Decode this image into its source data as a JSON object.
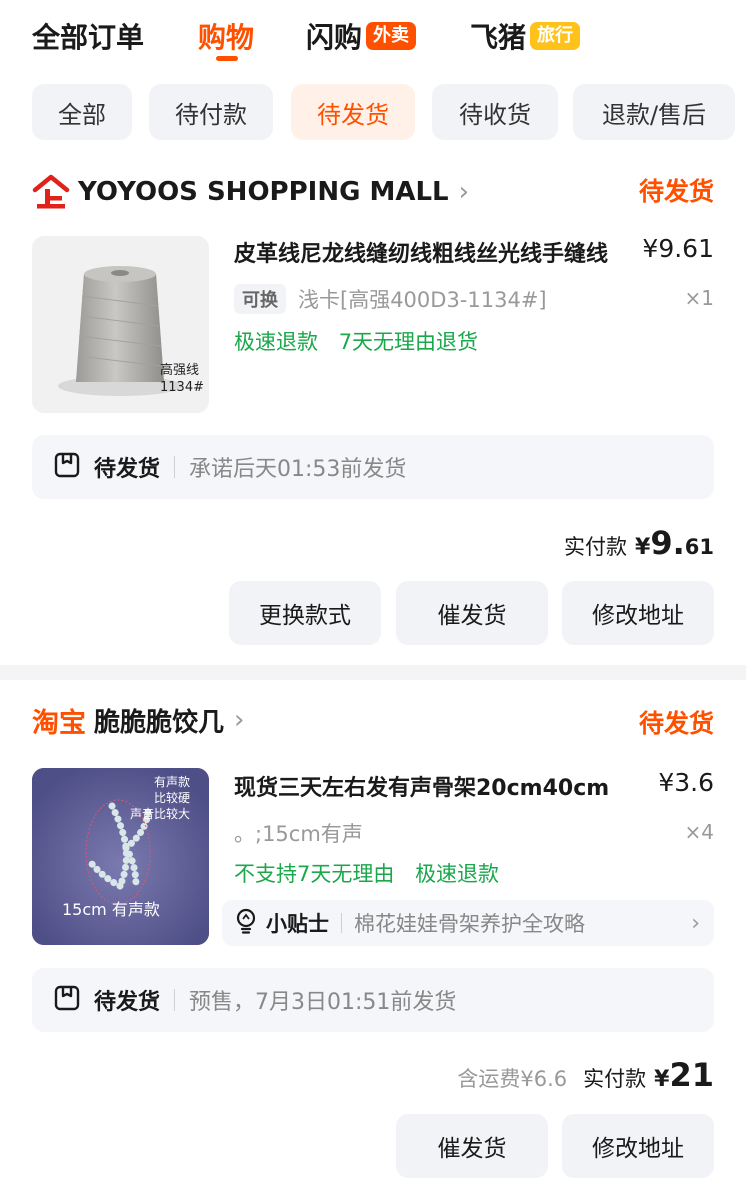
{
  "tabs": [
    {
      "label": "全部订单"
    },
    {
      "label": "购物"
    },
    {
      "label": "闪购",
      "badge": "外卖"
    },
    {
      "label": "飞猪",
      "badge": "旅行"
    }
  ],
  "filters": [
    "全部",
    "待付款",
    "待发货",
    "待收货",
    "退款/售后"
  ],
  "orders": [
    {
      "shop_name": "YOYOOS SHOPPING MALL",
      "status": "待发货",
      "title": "皮革线尼龙线缝纫线粗线丝光线手缝线",
      "price": "¥9.61",
      "spec_tag": "可换",
      "spec": "浅卡[高强400D3-1134#]",
      "qty": "×1",
      "services": [
        "极速退款",
        "7天无理由退货"
      ],
      "thumb_text": [
        "高强线",
        "1134#"
      ],
      "ship_title": "待发货",
      "ship_text": "承诺后天01:53前发货",
      "total_label": "实付款",
      "total_currency": "¥",
      "total_int": "9.",
      "total_dec": "61",
      "buttons": [
        "更换款式",
        "催发货",
        "修改地址"
      ]
    },
    {
      "shop_logo": "淘宝",
      "shop_name": "脆脆脆饺几",
      "status": "待发货",
      "title": "现货三天左右发有声骨架20cm40cm",
      "price": "¥3.6",
      "spec": "。;15cm有声",
      "qty": "×4",
      "services": [
        "不支持7天无理由",
        "极速退款"
      ],
      "thumb_text": [
        "有声款",
        "比较硬",
        "声音比较大",
        "15cm 有声款"
      ],
      "tip_title": "小贴士",
      "tip_text": "棉花娃娃骨架养护全攻略",
      "ship_title": "待发货",
      "ship_text": "预售，7月3日01:51前发货",
      "total_extra": "含运费¥6.6",
      "total_label": "实付款",
      "total_currency": "¥",
      "total_int": "21",
      "buttons": [
        "催发货",
        "修改地址"
      ]
    }
  ],
  "colors": {
    "accent": "#ff5000",
    "service_green": "#1aa84b",
    "badge_yellow": "#ffc21a"
  },
  "icons": [
    "qi-shop-logo-icon",
    "chevron-right-icon",
    "box-icon",
    "lightbulb-icon"
  ]
}
